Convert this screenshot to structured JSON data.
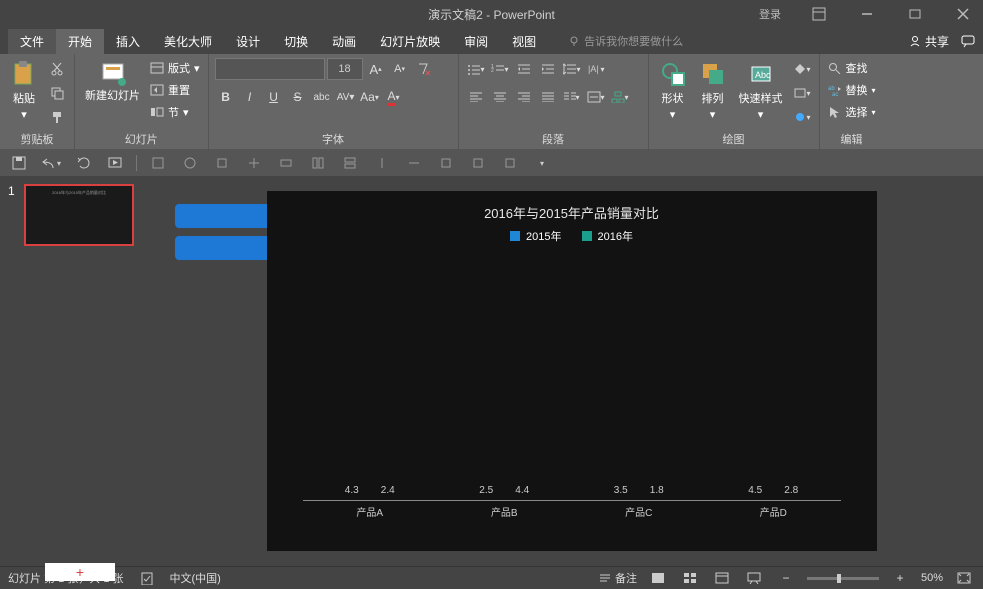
{
  "titlebar": {
    "title": "演示文稿2 - PowerPoint",
    "login": "登录"
  },
  "menubar": {
    "tabs": [
      "文件",
      "开始",
      "插入",
      "美化大师",
      "设计",
      "切换",
      "动画",
      "幻灯片放映",
      "审阅",
      "视图"
    ],
    "active_index": 1,
    "tell_me": "告诉我你想要做什么",
    "share": "共享"
  },
  "ribbon": {
    "clipboard": {
      "label": "剪贴板",
      "paste": "粘贴"
    },
    "slides": {
      "label": "幻灯片",
      "new_slide": "新建幻灯片",
      "layout": "版式",
      "reset": "重置",
      "section": "节"
    },
    "font": {
      "label": "字体",
      "size": "18"
    },
    "paragraph": {
      "label": "段落"
    },
    "drawing": {
      "label": "绘图",
      "shapes": "形状",
      "arrange": "排列",
      "quick_styles": "快速样式"
    },
    "editing": {
      "label": "编辑",
      "find": "查找",
      "replace": "替换",
      "select": "选择"
    }
  },
  "status": {
    "slide_info": "幻灯片 第 1 张，共 1 张",
    "language": "中文(中国)",
    "notes": "备注",
    "zoom": "50%"
  },
  "thumbnail": {
    "number": "1",
    "add": "+"
  },
  "chart_data": {
    "type": "bar",
    "title": "2016年与2015年产品销量对比",
    "categories": [
      "产品A",
      "产品B",
      "产品C",
      "产品D"
    ],
    "series": [
      {
        "name": "2015年",
        "color": "#1e88d6",
        "values": [
          4.3,
          2.5,
          3.5,
          4.5
        ]
      },
      {
        "name": "2016年",
        "color": "#1a9e8e",
        "values": [
          2.4,
          4.4,
          1.8,
          2.8
        ]
      }
    ],
    "ylim": [
      0,
      5
    ],
    "xlabel": "",
    "ylabel": ""
  }
}
